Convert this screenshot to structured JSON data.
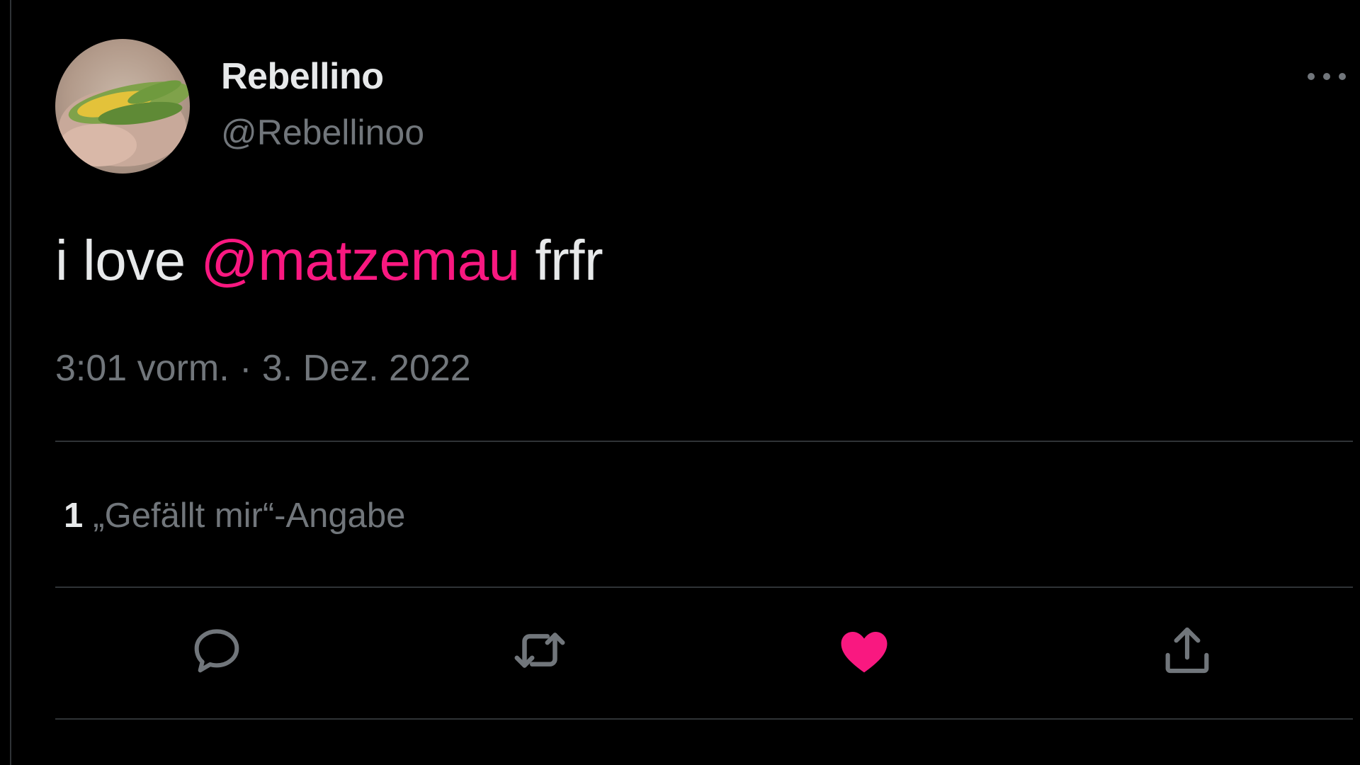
{
  "tweet": {
    "display_name": "Rebellino",
    "handle": "@Rebellinoo",
    "text_prefix": "i love ",
    "mention": "@matzemau",
    "text_suffix": " frfr",
    "timestamp": "3:01 vorm. · 3. Dez. 2022"
  },
  "stats": {
    "likes_count": "1",
    "likes_label": "„Gefällt mir“-Angabe"
  },
  "icons": {
    "more": "more-horizontal-icon",
    "reply": "reply-icon",
    "retweet": "retweet-icon",
    "like": "heart-icon",
    "share": "share-icon"
  },
  "colors": {
    "background": "#000000",
    "primary_text": "#e7e9ea",
    "secondary_text": "#71767b",
    "accent": "#f91880",
    "divider": "#2f3336"
  }
}
